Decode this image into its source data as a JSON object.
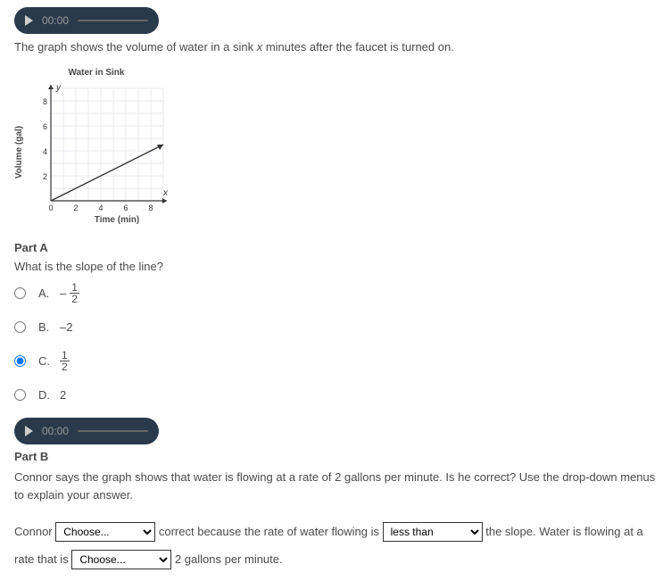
{
  "audio": {
    "time1": "00:00",
    "time2": "00:00"
  },
  "question": {
    "prefix": "The graph shows the volume of water in a sink ",
    "var": "x",
    "suffix": " minutes after the faucet is turned on."
  },
  "chart_data": {
    "type": "line",
    "title": "Water in Sink",
    "xlabel": "Time (min)",
    "ylabel": "Volume (gal)",
    "xaxis_var": "x",
    "yaxis_var": "y",
    "xlim": [
      0,
      9
    ],
    "ylim": [
      0,
      9
    ],
    "xticks": [
      0,
      2,
      4,
      6,
      8
    ],
    "yticks": [
      2,
      4,
      6,
      8
    ],
    "series": [
      {
        "name": "water",
        "points": [
          [
            0,
            0
          ],
          [
            9,
            4.5
          ]
        ]
      }
    ]
  },
  "partA": {
    "header": "Part A",
    "question": "What is the slope of the line?",
    "options": [
      {
        "letter": "A.",
        "display_type": "negfrac",
        "num": "1",
        "den": "2"
      },
      {
        "letter": "B.",
        "display_type": "text",
        "text": "–2"
      },
      {
        "letter": "C.",
        "display_type": "frac",
        "num": "1",
        "den": "2"
      },
      {
        "letter": "D.",
        "display_type": "text",
        "text": "2"
      }
    ],
    "selected_index": 2
  },
  "partB": {
    "header": "Part B",
    "prompt": "Connor says the graph shows that water is flowing at a rate of 2 gallons per minute. Is he correct? Use the drop-down menus to explain your answer.",
    "sentence": {
      "s1": "Connor ",
      "drop1_placeholder": "Choose...",
      "s2": " correct because the rate of water flowing is ",
      "drop2_selected": "less than",
      "s3": " the slope. Water is flowing at a rate that is ",
      "drop3_placeholder": "Choose...",
      "s4": " 2 gallons per minute."
    }
  }
}
